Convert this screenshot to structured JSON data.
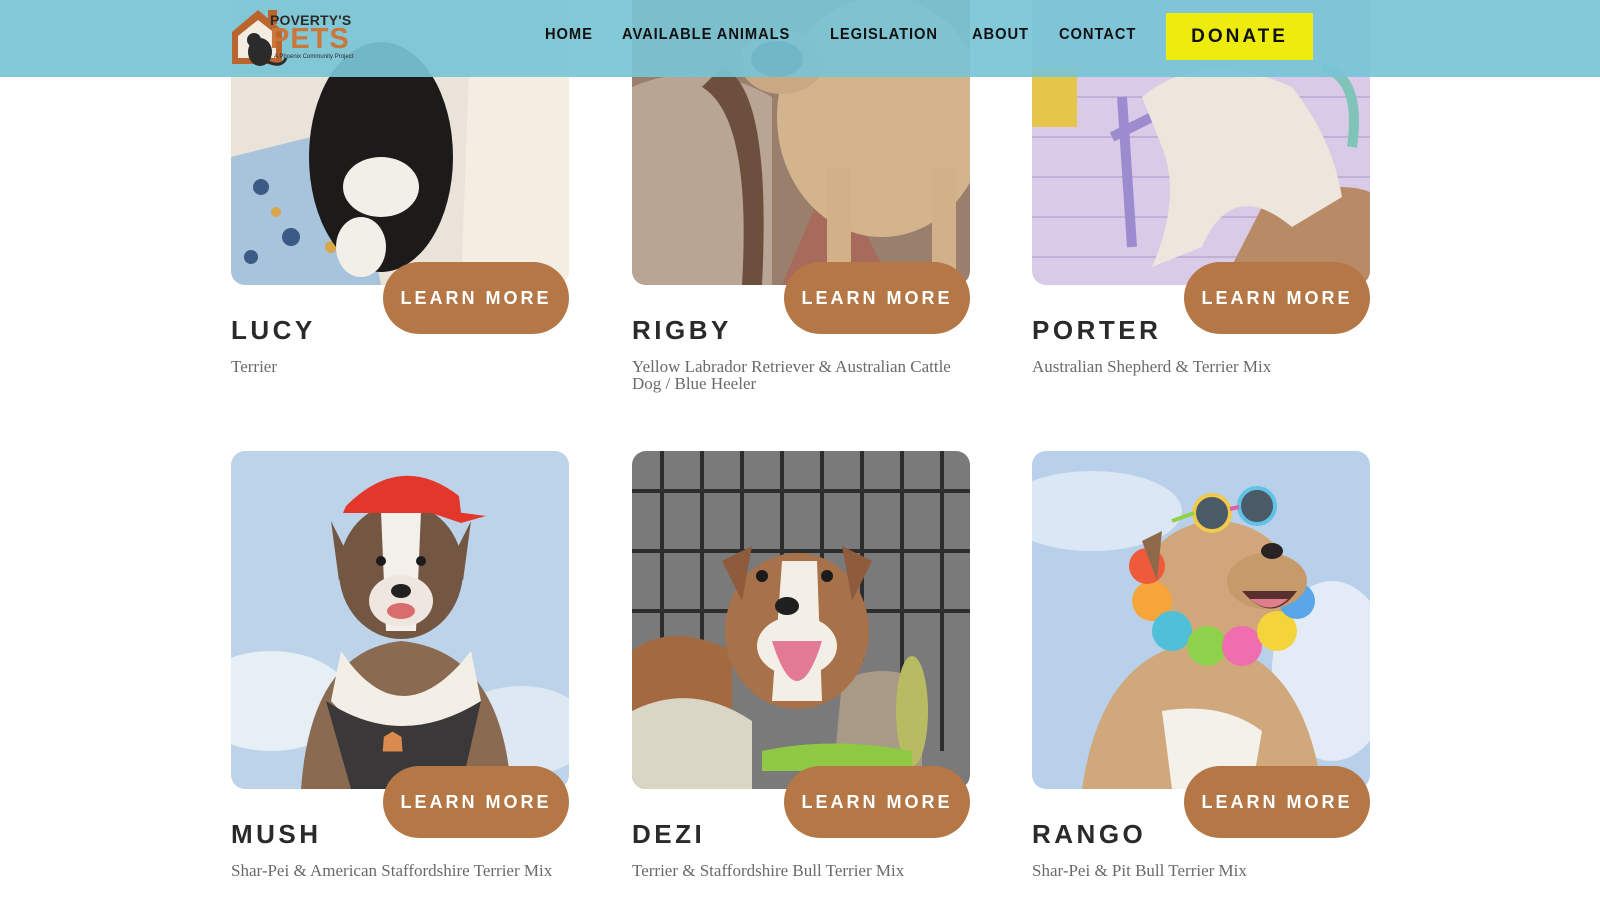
{
  "header": {
    "logo_line1": "POVERTY'S",
    "logo_line2": "PETS",
    "logo_line3": "A Phoenix Community Project",
    "nav": [
      "HOME",
      "AVAILABLE ANIMALS",
      "LEGISLATION",
      "ABOUT",
      "CONTACT"
    ],
    "donate_label": "DONATE"
  },
  "pets": [
    {
      "name": "LUCY",
      "breed": "Terrier",
      "button": "LEARN MORE"
    },
    {
      "name": "RIGBY",
      "breed": "Yellow Labrador Retriever & Australian Cattle Dog / Blue Heeler",
      "button": "LEARN MORE"
    },
    {
      "name": "PORTER",
      "breed": "Australian Shepherd & Terrier Mix",
      "button": "LEARN MORE"
    },
    {
      "name": "MUSH",
      "breed": "Shar-Pei & American Staffordshire Terrier Mix",
      "button": "LEARN MORE"
    },
    {
      "name": "DEZI",
      "breed": "Terrier & Staffordshire Bull Terrier Mix",
      "button": "LEARN MORE"
    },
    {
      "name": "RANGO",
      "breed": "Shar-Pei & Pit Bull Terrier Mix",
      "button": "LEARN MORE"
    }
  ],
  "colors": {
    "header_bg": "#78c4d6",
    "donate_bg": "#eeec0f",
    "button_bg": "#b47745",
    "name_text": "#2a2a2a",
    "breed_text": "#6a6a6a"
  }
}
